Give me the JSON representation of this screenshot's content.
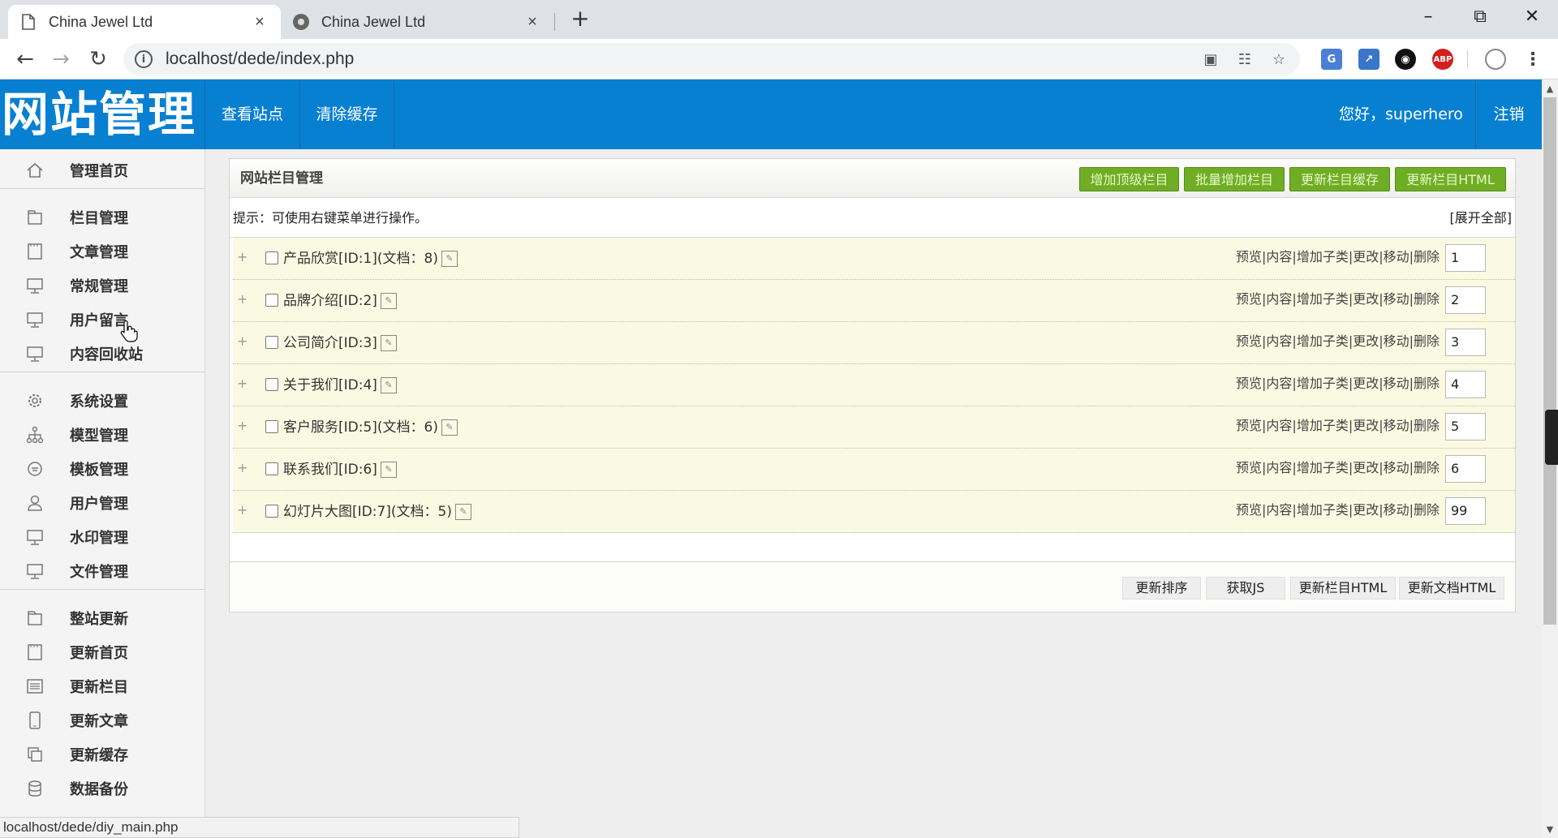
{
  "browser": {
    "tabs": [
      {
        "title": "China Jewel Ltd",
        "close": "×"
      },
      {
        "title": "China Jewel Ltd",
        "close": "×"
      }
    ],
    "new_tab": "+",
    "window_controls": {
      "minimize": "–",
      "restore": "⧉",
      "close": "✕"
    },
    "url": "localhost/dede/index.php",
    "status_url": "localhost/dede/diy_main.php",
    "extensions": {
      "abp_label": "ABP"
    }
  },
  "header": {
    "logo": "网站管理",
    "links": [
      "查看站点",
      "清除缓存"
    ],
    "greeting": "您好，superhero",
    "logout": "注销"
  },
  "sidebar": {
    "groups": [
      [
        {
          "label": "管理首页",
          "icon": "home-icon"
        }
      ],
      [
        {
          "label": "栏目管理",
          "icon": "folder-icon"
        },
        {
          "label": "文章管理",
          "icon": "document-icon"
        },
        {
          "label": "常规管理",
          "icon": "monitor-icon"
        },
        {
          "label": "用户留言",
          "icon": "monitor-icon"
        },
        {
          "label": "内容回收站",
          "icon": "monitor-icon"
        }
      ],
      [
        {
          "label": "系统设置",
          "icon": "gear-icon"
        },
        {
          "label": "模型管理",
          "icon": "sitemap-icon"
        },
        {
          "label": "模板管理",
          "icon": "template-icon"
        },
        {
          "label": "用户管理",
          "icon": "user-icon"
        },
        {
          "label": "水印管理",
          "icon": "monitor-icon"
        },
        {
          "label": "文件管理",
          "icon": "monitor-icon"
        }
      ],
      [
        {
          "label": "整站更新",
          "icon": "folder-icon"
        },
        {
          "label": "更新首页",
          "icon": "document-icon"
        },
        {
          "label": "更新栏目",
          "icon": "list-icon"
        },
        {
          "label": "更新文章",
          "icon": "phone-icon"
        },
        {
          "label": "更新缓存",
          "icon": "copy-icon"
        },
        {
          "label": "数据备份",
          "icon": "database-icon"
        }
      ]
    ]
  },
  "panel": {
    "title": "网站栏目管理",
    "buttons": [
      "增加顶级栏目",
      "批量增加栏目",
      "更新栏目缓存",
      "更新栏目HTML"
    ],
    "tip": "提示：可使用右键菜单进行操作。",
    "expand_all": "[展开全部]",
    "row_actions": "预览|内容|增加子类|更改|移动|删除",
    "rows": [
      {
        "name": "产品欣赏[ID:1](文档：8)",
        "order": "1"
      },
      {
        "name": "品牌介绍[ID:2]",
        "order": "2"
      },
      {
        "name": "公司简介[ID:3]",
        "order": "3"
      },
      {
        "name": "关于我们[ID:4]",
        "order": "4"
      },
      {
        "name": "客户服务[ID:5](文档：6)",
        "order": "5"
      },
      {
        "name": "联系我们[ID:6]",
        "order": "6"
      },
      {
        "name": "幻灯片大图[ID:7](文档：5)",
        "order": "99"
      }
    ],
    "footer_buttons": [
      "更新排序",
      "获取JS",
      "更新栏目HTML",
      "更新文档HTML"
    ]
  }
}
